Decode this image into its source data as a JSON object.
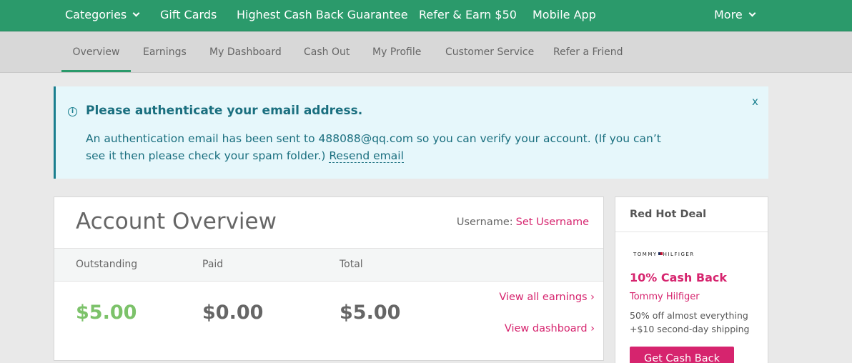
{
  "topnav": {
    "items": [
      {
        "label": "Categories"
      },
      {
        "label": "Gift Cards"
      },
      {
        "label": "Highest Cash Back Guarantee"
      },
      {
        "label": "Refer & Earn $50"
      },
      {
        "label": "Mobile App"
      },
      {
        "label": "More"
      }
    ]
  },
  "subnav": {
    "tabs": [
      {
        "label": "Overview",
        "active": true
      },
      {
        "label": "Earnings"
      },
      {
        "label": "My Dashboard"
      },
      {
        "label": "Cash Out"
      },
      {
        "label": "My Profile"
      },
      {
        "label": "Customer Service"
      },
      {
        "label": "Refer a Friend"
      }
    ]
  },
  "alert": {
    "title": "Please authenticate your email address.",
    "message": "An authentication email has been sent to 488088@qq.com so you can verify your account. (If you can’t see it then please check your spam folder.)",
    "resend_label": "Resend email",
    "close_label": "x"
  },
  "account": {
    "heading": "Account Overview",
    "username_label": "Username:",
    "username_link": "Set Username",
    "columns": [
      "Outstanding",
      "Paid",
      "Total"
    ],
    "outstanding": "$5.00",
    "paid": "$0.00",
    "total": "$5.00",
    "view_earnings": "View all earnings ›",
    "view_dashboard": "View dashboard ›"
  },
  "deal": {
    "header": "Red Hot Deal",
    "logo_left": "TOMMY",
    "logo_right": "HILFIGER",
    "rate": "10% Cash Back",
    "store": "Tommy Hilfiger",
    "desc1": "50% off almost everything",
    "desc2": "+$10 second-day shipping",
    "button": "Get Cash Back"
  },
  "colors": {
    "brand_green": "#2b9a6b",
    "accent_pink": "#d6246e",
    "positive_green": "#7cc26a",
    "alert_teal": "#1a6f7f"
  }
}
